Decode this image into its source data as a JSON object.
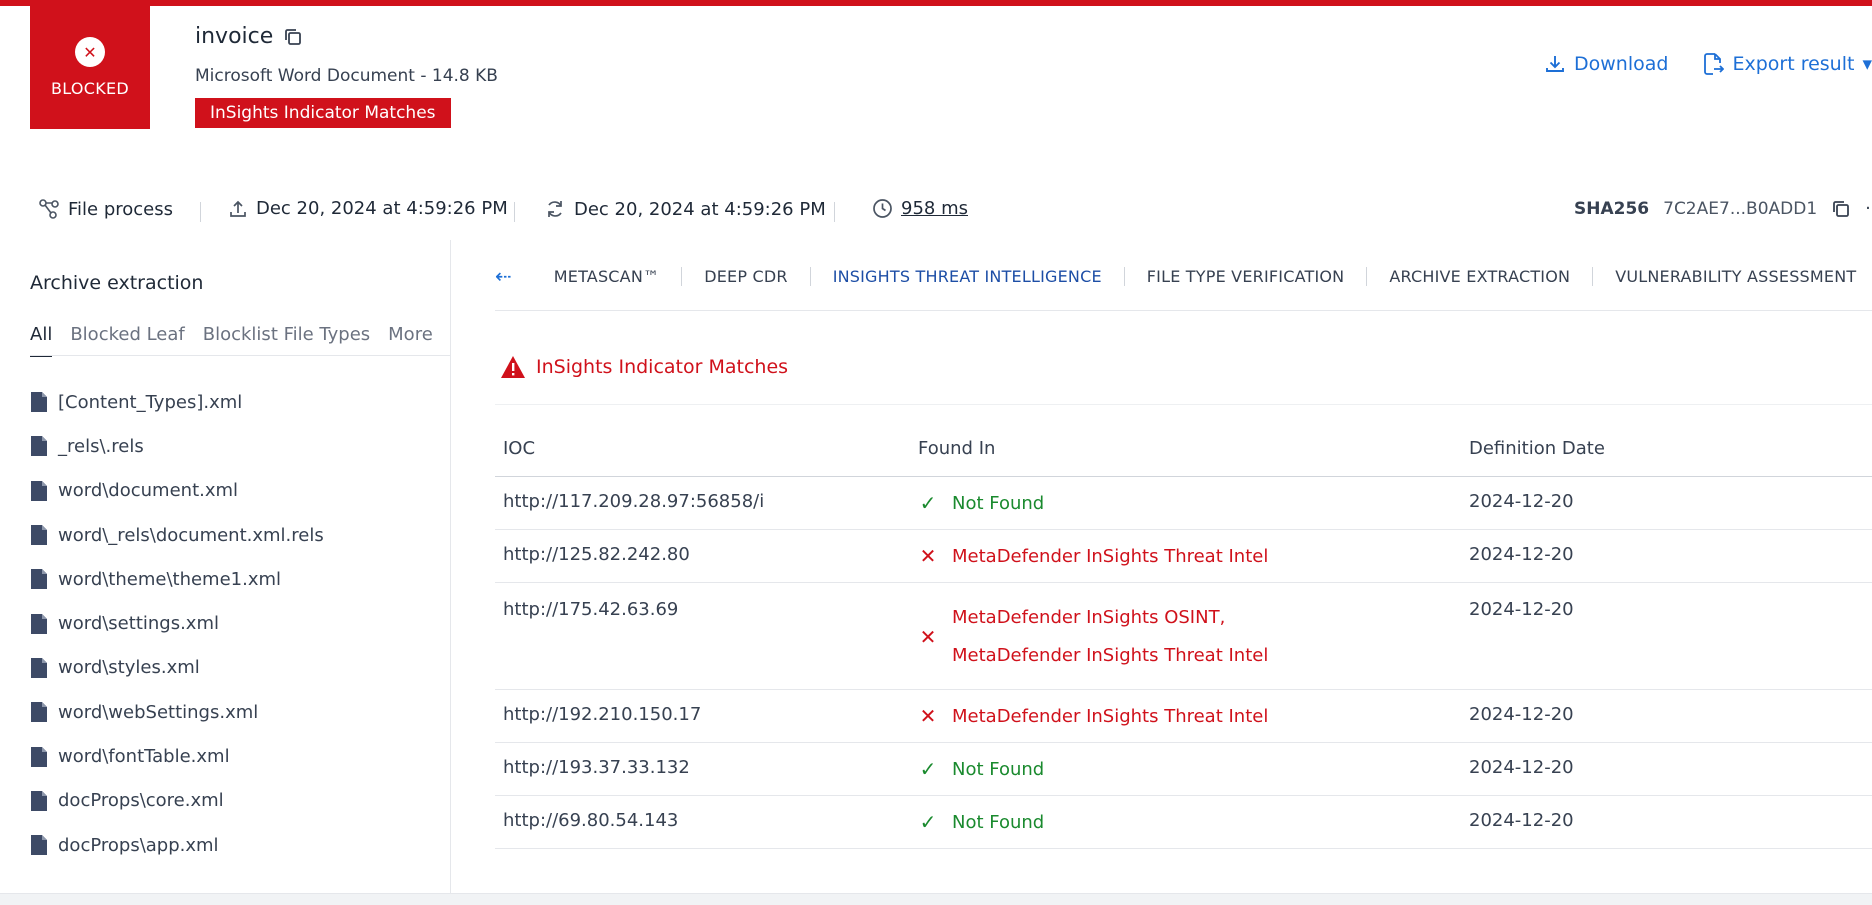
{
  "header": {
    "status_label": "BLOCKED",
    "file_name": "invoice",
    "file_meta": "Microsoft Word Document - 14.8 KB",
    "result_badge": "InSights Indicator Matches",
    "actions": {
      "download": "Download",
      "export": "Export result"
    }
  },
  "info": {
    "process_label": "File process",
    "uploaded": "Dec 20, 2024 at 4:59:26 PM",
    "processed": "Dec 20, 2024 at 4:59:26 PM",
    "duration": "958 ms",
    "sha_label": "SHA256",
    "sha_value": "7C2AE7...B0ADD1"
  },
  "sidebar": {
    "title": "Archive extraction",
    "tabs": [
      "All",
      "Blocked Leaf",
      "Blocklist File Types",
      "More"
    ],
    "files": [
      "[Content_Types].xml",
      "_rels\\.rels",
      "word\\document.xml",
      "word\\_rels\\document.xml.rels",
      "word\\theme\\theme1.xml",
      "word\\settings.xml",
      "word\\styles.xml",
      "word\\webSettings.xml",
      "word\\fontTable.xml",
      "docProps\\core.xml",
      "docProps\\app.xml"
    ]
  },
  "engine_tabs": [
    "METASCAN™",
    "DEEP CDR",
    "INSIGHTS THREAT INTELLIGENCE",
    "FILE TYPE VERIFICATION",
    "ARCHIVE EXTRACTION",
    "VULNERABILITY ASSESSMENT"
  ],
  "section_title": "InSights Indicator Matches",
  "table": {
    "headers": [
      "IOC",
      "Found In",
      "Definition Date"
    ],
    "rows": [
      {
        "ioc": "http://117.209.28.97:56858/i",
        "found": [
          "Not Found"
        ],
        "status": "ok",
        "date": "2024-12-20"
      },
      {
        "ioc": "http://125.82.242.80",
        "found": [
          "MetaDefender InSights Threat Intel"
        ],
        "status": "bad",
        "date": "2024-12-20"
      },
      {
        "ioc": "http://175.42.63.69",
        "found": [
          "MetaDefender InSights OSINT,",
          "MetaDefender InSights Threat Intel"
        ],
        "status": "bad",
        "date": "2024-12-20"
      },
      {
        "ioc": "http://192.210.150.17",
        "found": [
          "MetaDefender InSights Threat Intel"
        ],
        "status": "bad",
        "date": "2024-12-20"
      },
      {
        "ioc": "http://193.37.33.132",
        "found": [
          "Not Found"
        ],
        "status": "ok",
        "date": "2024-12-20"
      },
      {
        "ioc": "http://69.80.54.143",
        "found": [
          "Not Found"
        ],
        "status": "ok",
        "date": "2024-12-20"
      }
    ]
  },
  "colors": {
    "danger": "#d0111b",
    "accent": "#1d6fd6",
    "ok": "#1a8a2e"
  },
  "icons": [
    "close-icon",
    "copy-icon",
    "download-icon",
    "export-icon",
    "file-process-icon",
    "upload-icon",
    "refresh-icon",
    "clock-icon",
    "more-icon",
    "back-arrow-icon",
    "warning-icon",
    "file-icon",
    "check-icon",
    "x-icon"
  ]
}
